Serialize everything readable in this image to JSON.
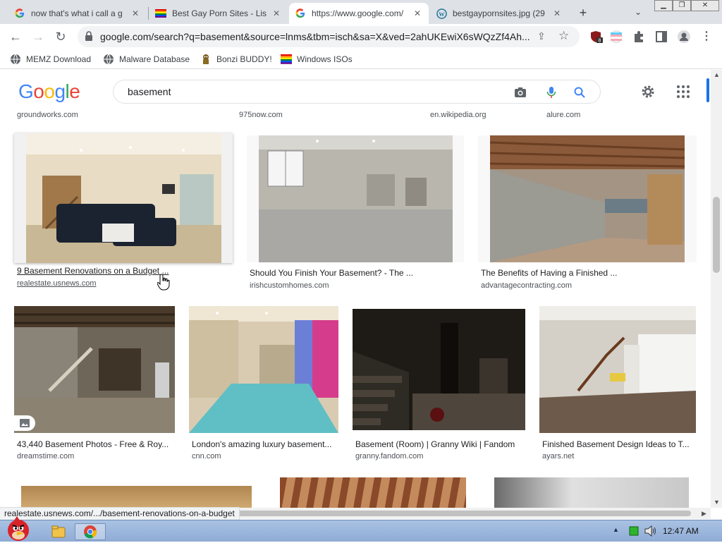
{
  "tabs": [
    {
      "title": "now that's what i call a g",
      "favicon": "google-icon",
      "active": false
    },
    {
      "title": "Best Gay Porn Sites - List",
      "favicon": "rainbow-flag-icon",
      "active": false
    },
    {
      "title": "https://www.google.com/",
      "favicon": "google-icon",
      "active": true
    },
    {
      "title": "bestgaypornsites.jpg (29",
      "favicon": "wordpress-icon",
      "active": false
    }
  ],
  "toolbar": {
    "url": "google.com/search?q=basement&source=lnms&tbm=isch&sa=X&ved=2ahUKEwiX6sWQzZf4Ah...",
    "extension_badge": "8"
  },
  "bookmarks": [
    {
      "label": "MEMZ Download",
      "icon": "globe-icon"
    },
    {
      "label": "Malware Database",
      "icon": "globe-icon"
    },
    {
      "label": "Bonzi BUDDY!",
      "icon": "bonzi-icon"
    },
    {
      "label": "Windows ISOs",
      "icon": "windows-flag-icon"
    }
  ],
  "search": {
    "query": "basement"
  },
  "top_sources": [
    "groundworks.com",
    "975now.com",
    "en.wikipedia.org",
    "alure.com"
  ],
  "results_row1": [
    {
      "caption": "9 Basement Renovations on a Budget ...",
      "source": "realestate.usnews.com"
    },
    {
      "caption": "Should You Finish Your Basement? - The ...",
      "source": "irishcustomhomes.com"
    },
    {
      "caption": "The Benefits of Having a Finished ...",
      "source": "advantagecontracting.com"
    }
  ],
  "results_row2": [
    {
      "caption": "43,440 Basement Photos - Free & Roy...",
      "source": "dreamstime.com"
    },
    {
      "caption": "London's amazing luxury basement...",
      "source": "cnn.com"
    },
    {
      "caption": "Basement (Room) | Granny Wiki | Fandom",
      "source": "granny.fandom.com"
    },
    {
      "caption": "Finished Basement Design Ideas to T...",
      "source": "ayars.net"
    }
  ],
  "status_url": "realestate.usnews.com/.../basement-renovations-on-a-budget",
  "taskbar": {
    "clock": "12:47 AM"
  },
  "colors": {
    "google_blue": "#4285f4",
    "google_red": "#ea4335",
    "google_yellow": "#fbbc05",
    "google_green": "#34a853",
    "accent": "#1a73e8"
  }
}
